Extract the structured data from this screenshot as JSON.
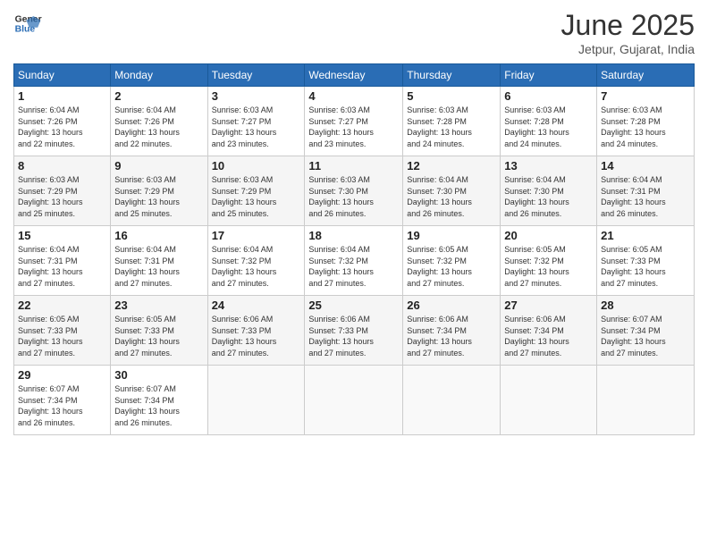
{
  "header": {
    "logo_line1": "General",
    "logo_line2": "Blue",
    "month": "June 2025",
    "location": "Jetpur, Gujarat, India"
  },
  "weekdays": [
    "Sunday",
    "Monday",
    "Tuesday",
    "Wednesday",
    "Thursday",
    "Friday",
    "Saturday"
  ],
  "weeks": [
    [
      {
        "day": "1",
        "info": "Sunrise: 6:04 AM\nSunset: 7:26 PM\nDaylight: 13 hours\nand 22 minutes."
      },
      {
        "day": "2",
        "info": "Sunrise: 6:04 AM\nSunset: 7:26 PM\nDaylight: 13 hours\nand 22 minutes."
      },
      {
        "day": "3",
        "info": "Sunrise: 6:03 AM\nSunset: 7:27 PM\nDaylight: 13 hours\nand 23 minutes."
      },
      {
        "day": "4",
        "info": "Sunrise: 6:03 AM\nSunset: 7:27 PM\nDaylight: 13 hours\nand 23 minutes."
      },
      {
        "day": "5",
        "info": "Sunrise: 6:03 AM\nSunset: 7:28 PM\nDaylight: 13 hours\nand 24 minutes."
      },
      {
        "day": "6",
        "info": "Sunrise: 6:03 AM\nSunset: 7:28 PM\nDaylight: 13 hours\nand 24 minutes."
      },
      {
        "day": "7",
        "info": "Sunrise: 6:03 AM\nSunset: 7:28 PM\nDaylight: 13 hours\nand 24 minutes."
      }
    ],
    [
      {
        "day": "8",
        "info": "Sunrise: 6:03 AM\nSunset: 7:29 PM\nDaylight: 13 hours\nand 25 minutes."
      },
      {
        "day": "9",
        "info": "Sunrise: 6:03 AM\nSunset: 7:29 PM\nDaylight: 13 hours\nand 25 minutes."
      },
      {
        "day": "10",
        "info": "Sunrise: 6:03 AM\nSunset: 7:29 PM\nDaylight: 13 hours\nand 25 minutes."
      },
      {
        "day": "11",
        "info": "Sunrise: 6:03 AM\nSunset: 7:30 PM\nDaylight: 13 hours\nand 26 minutes."
      },
      {
        "day": "12",
        "info": "Sunrise: 6:04 AM\nSunset: 7:30 PM\nDaylight: 13 hours\nand 26 minutes."
      },
      {
        "day": "13",
        "info": "Sunrise: 6:04 AM\nSunset: 7:30 PM\nDaylight: 13 hours\nand 26 minutes."
      },
      {
        "day": "14",
        "info": "Sunrise: 6:04 AM\nSunset: 7:31 PM\nDaylight: 13 hours\nand 26 minutes."
      }
    ],
    [
      {
        "day": "15",
        "info": "Sunrise: 6:04 AM\nSunset: 7:31 PM\nDaylight: 13 hours\nand 27 minutes."
      },
      {
        "day": "16",
        "info": "Sunrise: 6:04 AM\nSunset: 7:31 PM\nDaylight: 13 hours\nand 27 minutes."
      },
      {
        "day": "17",
        "info": "Sunrise: 6:04 AM\nSunset: 7:32 PM\nDaylight: 13 hours\nand 27 minutes."
      },
      {
        "day": "18",
        "info": "Sunrise: 6:04 AM\nSunset: 7:32 PM\nDaylight: 13 hours\nand 27 minutes."
      },
      {
        "day": "19",
        "info": "Sunrise: 6:05 AM\nSunset: 7:32 PM\nDaylight: 13 hours\nand 27 minutes."
      },
      {
        "day": "20",
        "info": "Sunrise: 6:05 AM\nSunset: 7:32 PM\nDaylight: 13 hours\nand 27 minutes."
      },
      {
        "day": "21",
        "info": "Sunrise: 6:05 AM\nSunset: 7:33 PM\nDaylight: 13 hours\nand 27 minutes."
      }
    ],
    [
      {
        "day": "22",
        "info": "Sunrise: 6:05 AM\nSunset: 7:33 PM\nDaylight: 13 hours\nand 27 minutes."
      },
      {
        "day": "23",
        "info": "Sunrise: 6:05 AM\nSunset: 7:33 PM\nDaylight: 13 hours\nand 27 minutes."
      },
      {
        "day": "24",
        "info": "Sunrise: 6:06 AM\nSunset: 7:33 PM\nDaylight: 13 hours\nand 27 minutes."
      },
      {
        "day": "25",
        "info": "Sunrise: 6:06 AM\nSunset: 7:33 PM\nDaylight: 13 hours\nand 27 minutes."
      },
      {
        "day": "26",
        "info": "Sunrise: 6:06 AM\nSunset: 7:34 PM\nDaylight: 13 hours\nand 27 minutes."
      },
      {
        "day": "27",
        "info": "Sunrise: 6:06 AM\nSunset: 7:34 PM\nDaylight: 13 hours\nand 27 minutes."
      },
      {
        "day": "28",
        "info": "Sunrise: 6:07 AM\nSunset: 7:34 PM\nDaylight: 13 hours\nand 27 minutes."
      }
    ],
    [
      {
        "day": "29",
        "info": "Sunrise: 6:07 AM\nSunset: 7:34 PM\nDaylight: 13 hours\nand 26 minutes."
      },
      {
        "day": "30",
        "info": "Sunrise: 6:07 AM\nSunset: 7:34 PM\nDaylight: 13 hours\nand 26 minutes."
      },
      {
        "day": "",
        "info": ""
      },
      {
        "day": "",
        "info": ""
      },
      {
        "day": "",
        "info": ""
      },
      {
        "day": "",
        "info": ""
      },
      {
        "day": "",
        "info": ""
      }
    ]
  ]
}
